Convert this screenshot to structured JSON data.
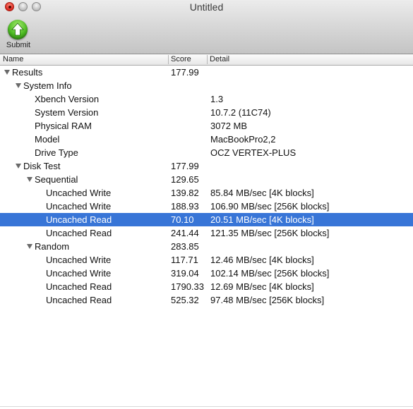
{
  "window": {
    "title": "Untitled"
  },
  "toolbar": {
    "submit_label": "Submit"
  },
  "columns": {
    "name": "Name",
    "score": "Score",
    "detail": "Detail"
  },
  "rows": [
    {
      "name": "Results",
      "score": "177.99",
      "detail": ""
    },
    {
      "name": "System Info",
      "score": "",
      "detail": ""
    },
    {
      "name": "Xbench Version",
      "score": "",
      "detail": "1.3"
    },
    {
      "name": "System Version",
      "score": "",
      "detail": "10.7.2 (11C74)"
    },
    {
      "name": "Physical RAM",
      "score": "",
      "detail": "3072 MB"
    },
    {
      "name": "Model",
      "score": "",
      "detail": "MacBookPro2,2"
    },
    {
      "name": "Drive Type",
      "score": "",
      "detail": "OCZ VERTEX-PLUS"
    },
    {
      "name": "Disk Test",
      "score": "177.99",
      "detail": ""
    },
    {
      "name": "Sequential",
      "score": "129.65",
      "detail": ""
    },
    {
      "name": "Uncached Write",
      "score": "139.82",
      "detail": "85.84 MB/sec [4K blocks]"
    },
    {
      "name": "Uncached Write",
      "score": "188.93",
      "detail": "106.90 MB/sec [256K blocks]"
    },
    {
      "name": "Uncached Read",
      "score": "70.10",
      "detail": "20.51 MB/sec [4K blocks]"
    },
    {
      "name": "Uncached Read",
      "score": "241.44",
      "detail": "121.35 MB/sec [256K blocks]"
    },
    {
      "name": "Random",
      "score": "283.85",
      "detail": ""
    },
    {
      "name": "Uncached Write",
      "score": "117.71",
      "detail": "12.46 MB/sec [4K blocks]"
    },
    {
      "name": "Uncached Write",
      "score": "319.04",
      "detail": "102.14 MB/sec [256K blocks]"
    },
    {
      "name": "Uncached Read",
      "score": "1790.33",
      "detail": "12.69 MB/sec [4K blocks]"
    },
    {
      "name": "Uncached Read",
      "score": "525.32",
      "detail": "97.48 MB/sec [256K blocks]"
    }
  ],
  "selected_row": 11,
  "icons": {
    "submit": "up-arrow-icon",
    "disclosure": "disclosure-triangle-icon"
  },
  "colors": {
    "selection": "#3875d7",
    "submit_green": "#4cba22"
  }
}
